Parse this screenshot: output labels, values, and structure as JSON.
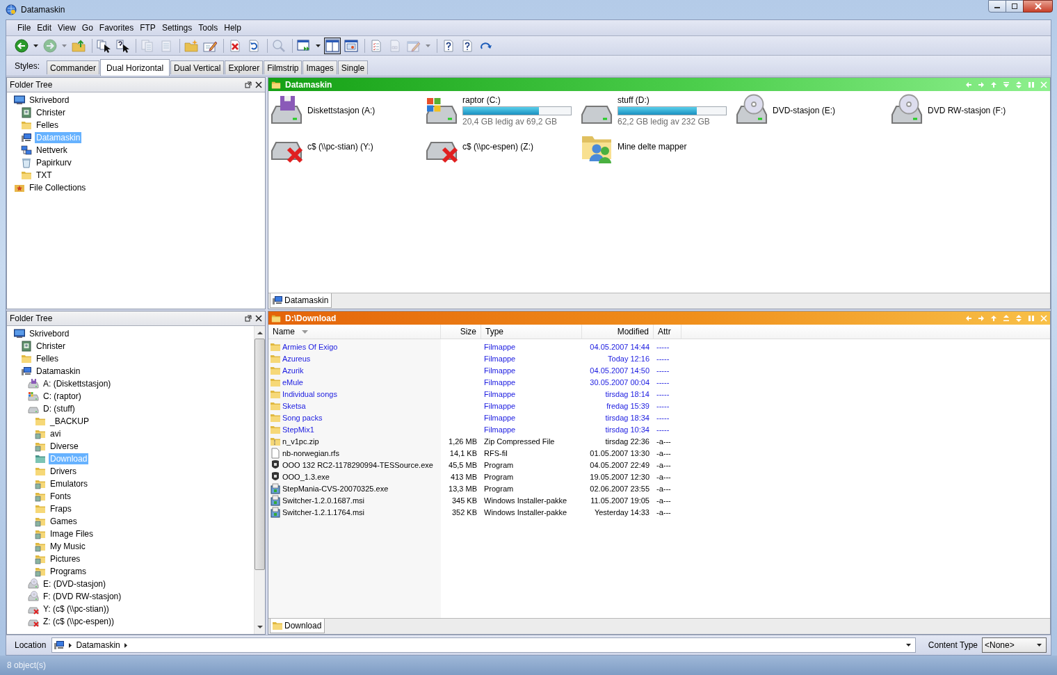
{
  "window": {
    "title": "Datamaskin"
  },
  "menu": [
    "File",
    "Edit",
    "View",
    "Go",
    "Favorites",
    "FTP",
    "Settings",
    "Tools",
    "Help"
  ],
  "toolbar": [
    {
      "kind": "back",
      "selected": false,
      "disabled": false
    },
    {
      "kind": "dropdown",
      "selected": false,
      "disabled": false
    },
    {
      "kind": "forward",
      "selected": false,
      "disabled": true
    },
    {
      "kind": "dropdown",
      "selected": false,
      "disabled": true
    },
    {
      "kind": "up",
      "selected": false,
      "disabled": false
    },
    {
      "kind": "separator"
    },
    {
      "kind": "copy-cursor",
      "selected": false,
      "disabled": false
    },
    {
      "kind": "help-cursor",
      "selected": false,
      "disabled": false
    },
    {
      "kind": "separator"
    },
    {
      "kind": "copy",
      "selected": false,
      "disabled": true
    },
    {
      "kind": "paste",
      "selected": false,
      "disabled": true
    },
    {
      "kind": "separator"
    },
    {
      "kind": "new-folder",
      "selected": false,
      "disabled": false
    },
    {
      "kind": "rename",
      "selected": false,
      "disabled": false
    },
    {
      "kind": "separator"
    },
    {
      "kind": "delete",
      "selected": false,
      "disabled": false
    },
    {
      "kind": "undo",
      "selected": false,
      "disabled": false
    },
    {
      "kind": "separator"
    },
    {
      "kind": "search",
      "selected": false,
      "disabled": true
    },
    {
      "kind": "separator"
    },
    {
      "kind": "panel",
      "selected": false,
      "disabled": false
    },
    {
      "kind": "dropdown",
      "selected": false,
      "disabled": false
    },
    {
      "kind": "dual",
      "selected": true,
      "disabled": false
    },
    {
      "kind": "dual-v",
      "selected": false,
      "disabled": false
    },
    {
      "kind": "separator"
    },
    {
      "kind": "checklist",
      "selected": false,
      "disabled": false
    },
    {
      "kind": "blank",
      "selected": false,
      "disabled": true
    },
    {
      "kind": "edit",
      "selected": false,
      "disabled": true
    },
    {
      "kind": "dropdown",
      "selected": false,
      "disabled": true
    },
    {
      "kind": "separator"
    },
    {
      "kind": "help",
      "selected": false,
      "disabled": false
    },
    {
      "kind": "help",
      "selected": false,
      "disabled": false
    },
    {
      "kind": "redo",
      "selected": false,
      "disabled": false
    }
  ],
  "styles": {
    "label": "Styles:",
    "tabs": [
      {
        "label": "Commander",
        "selected": false
      },
      {
        "label": "Dual Horizontal",
        "selected": true
      },
      {
        "label": "Dual Vertical",
        "selected": false
      },
      {
        "label": "Explorer",
        "selected": false
      },
      {
        "label": "Filmstrip",
        "selected": false
      },
      {
        "label": "Images",
        "selected": false
      },
      {
        "label": "Single",
        "selected": false
      }
    ]
  },
  "tree_top": {
    "title": "Folder Tree",
    "items": [
      {
        "kind": "desktop",
        "label": "Skrivebord",
        "selected": false,
        "children": [
          {
            "kind": "user",
            "label": "Christer",
            "selected": false
          },
          {
            "kind": "folder",
            "label": "Felles",
            "selected": false
          },
          {
            "kind": "computer",
            "label": "Datamaskin",
            "selected": true
          },
          {
            "kind": "network",
            "label": "Nettverk",
            "selected": false
          },
          {
            "kind": "recycle",
            "label": "Papirkurv",
            "selected": false
          },
          {
            "kind": "folder",
            "label": "TXT",
            "selected": false
          }
        ]
      },
      {
        "kind": "collection",
        "label": "File Collections",
        "selected": false
      }
    ]
  },
  "drives_pane": {
    "title": "Datamaskin",
    "items": [
      {
        "kind": "floppy",
        "name": "Diskettstasjon (A:)"
      },
      {
        "kind": "windrive",
        "name": "raptor (C:)",
        "level": 0.7,
        "free": "20,4 GB ledig av 69,2 GB"
      },
      {
        "kind": "drive",
        "name": "stuff (D:)",
        "level": 0.73,
        "free": "62,2 GB ledig av 232 GB"
      },
      {
        "kind": "dvd",
        "name": "DVD-stasjon (E:)"
      },
      {
        "kind": "dvd",
        "name": "DVD RW-stasjon (F:)"
      },
      {
        "kind": "netdrive",
        "name": "c$ (\\\\pc-stian) (Y:)"
      },
      {
        "kind": "netdrive",
        "name": "c$ (\\\\pc-espen) (Z:)"
      },
      {
        "kind": "shared",
        "name": "Mine delte mapper"
      }
    ],
    "tab": "Datamaskin"
  },
  "tree_bottom": {
    "title": "Folder Tree",
    "items": [
      {
        "kind": "desktop",
        "label": "Skrivebord",
        "selected": false,
        "children": [
          {
            "kind": "user",
            "label": "Christer",
            "selected": false
          },
          {
            "kind": "folder",
            "label": "Felles",
            "selected": false
          },
          {
            "kind": "computer",
            "label": "Datamaskin",
            "selected": false,
            "children": [
              {
                "kind": "floppy",
                "label": "A: (Diskettstasjon)",
                "selected": false
              },
              {
                "kind": "windrive",
                "label": "C: (raptor)",
                "selected": false
              },
              {
                "kind": "drive",
                "label": "D: (stuff)",
                "selected": false,
                "children": [
                  {
                    "kind": "folder",
                    "label": "_BACKUP",
                    "selected": false
                  },
                  {
                    "kind": "media-folder",
                    "label": "avi",
                    "selected": false
                  },
                  {
                    "kind": "media-folder",
                    "label": "Diverse",
                    "selected": false
                  },
                  {
                    "kind": "active-folder",
                    "label": "Download",
                    "selected": true
                  },
                  {
                    "kind": "folder",
                    "label": "Drivers",
                    "selected": false
                  },
                  {
                    "kind": "media-folder",
                    "label": "Emulators",
                    "selected": false
                  },
                  {
                    "kind": "media-folder",
                    "label": "Fonts",
                    "selected": false
                  },
                  {
                    "kind": "folder",
                    "label": "Fraps",
                    "selected": false
                  },
                  {
                    "kind": "media-folder",
                    "label": "Games",
                    "selected": false
                  },
                  {
                    "kind": "media-folder",
                    "label": "Image Files",
                    "selected": false
                  },
                  {
                    "kind": "media-folder",
                    "label": "My Music",
                    "selected": false
                  },
                  {
                    "kind": "media-folder",
                    "label": "Pictures",
                    "selected": false
                  },
                  {
                    "kind": "media-folder",
                    "label": "Programs",
                    "selected": false
                  }
                ]
              },
              {
                "kind": "dvd",
                "label": "E: (DVD-stasjon)",
                "selected": false
              },
              {
                "kind": "dvd",
                "label": "F: (DVD RW-stasjon)",
                "selected": false
              },
              {
                "kind": "netdrive",
                "label": "Y: (c$ (\\\\pc-stian))",
                "selected": false
              },
              {
                "kind": "netdrive",
                "label": "Z: (c$ (\\\\pc-espen))",
                "selected": false
              }
            ]
          }
        ]
      }
    ]
  },
  "files_pane": {
    "title": "D:\\Download",
    "columns": [
      "Name",
      "Size",
      "Type",
      "Modified",
      "Attr"
    ],
    "rows": [
      {
        "kind": "folder",
        "name": "Armies Of Exigo",
        "type": "Filmappe",
        "modified": "04.05.2007 14:44",
        "attr": "-----"
      },
      {
        "kind": "folder",
        "name": "Azureus",
        "type": "Filmappe",
        "modified": "Today 12:16",
        "attr": "-----"
      },
      {
        "kind": "folder",
        "name": "Azurik",
        "type": "Filmappe",
        "modified": "04.05.2007 14:50",
        "attr": "-----"
      },
      {
        "kind": "folder",
        "name": "eMule",
        "type": "Filmappe",
        "modified": "30.05.2007 00:04",
        "attr": "-----"
      },
      {
        "kind": "folder",
        "name": "Individual songs",
        "type": "Filmappe",
        "modified": "tirsdag 18:14",
        "attr": "-----"
      },
      {
        "kind": "folder",
        "name": "Sketsa",
        "type": "Filmappe",
        "modified": "fredag 15:39",
        "attr": "-----"
      },
      {
        "kind": "folder",
        "name": "Song packs",
        "type": "Filmappe",
        "modified": "tirsdag 18:34",
        "attr": "-----"
      },
      {
        "kind": "folder",
        "name": "StepMix1",
        "type": "Filmappe",
        "modified": "tirsdag 10:34",
        "attr": "-----"
      },
      {
        "kind": "zip",
        "name": "n_v1pc.zip",
        "size": "1,26 MB",
        "type": "Zip Compressed File",
        "modified": "tirsdag 22:36",
        "attr": "-a---"
      },
      {
        "kind": "file",
        "name": "nb-norwegian.rfs",
        "size": "14,1 KB",
        "type": "RFS-fil",
        "modified": "01.05.2007 13:30",
        "attr": "-a---"
      },
      {
        "kind": "exe",
        "name": "OOO 132 RC2-1178290994-TESSource.exe",
        "size": "45,5 MB",
        "type": "Program",
        "modified": "04.05.2007 22:49",
        "attr": "-a---"
      },
      {
        "kind": "exe",
        "name": "OOO_1.3.exe",
        "size": "413 MB",
        "type": "Program",
        "modified": "19.05.2007 12:30",
        "attr": "-a---"
      },
      {
        "kind": "msi",
        "name": "StepMania-CVS-20070325.exe",
        "size": "13,3 MB",
        "type": "Program",
        "modified": "02.06.2007 23:55",
        "attr": "-a---"
      },
      {
        "kind": "msi",
        "name": "Switcher-1.2.0.1687.msi",
        "size": "345 KB",
        "type": "Windows Installer-pakke",
        "modified": "11.05.2007 19:05",
        "attr": "-a---"
      },
      {
        "kind": "msi",
        "name": "Switcher-1.2.1.1764.msi",
        "size": "352 KB",
        "type": "Windows Installer-pakke",
        "modified": "Yesterday 14:33",
        "attr": "-a---"
      }
    ],
    "tab": "Download"
  },
  "location": {
    "label": "Location",
    "crumbs": [
      "Datamaskin"
    ],
    "content_type_label": "Content Type",
    "content_type": "<None>"
  },
  "status_bar": "8 object(s)"
}
